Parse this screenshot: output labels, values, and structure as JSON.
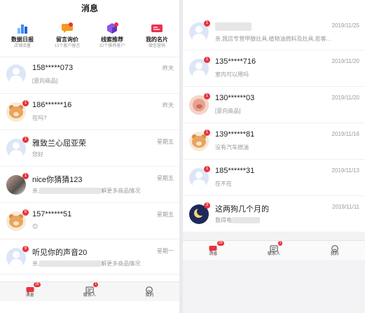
{
  "left": {
    "title": "消息",
    "tools": [
      {
        "title": "数据日报",
        "sub": "店铺流量",
        "icon": "bar-chart-icon",
        "color": "#3b8cf5"
      },
      {
        "title": "留言询价",
        "sub": "13个客户留言",
        "icon": "message-icon",
        "color": "#f29a1f"
      },
      {
        "title": "线索推荐",
        "sub": "32个推荐客户",
        "icon": "cube-icon",
        "color": "#8b57e8"
      },
      {
        "title": "我的名片",
        "sub": "微信营销",
        "icon": "card-icon",
        "color": "#e8334f"
      }
    ],
    "rows": [
      {
        "name": "158*****073",
        "time": "昨天",
        "preview": "[意向商品]",
        "avatar": "default",
        "badge": ""
      },
      {
        "name": "186******16",
        "time": "昨天",
        "preview": "在吗?",
        "avatar": "bear",
        "badge": "1"
      },
      {
        "name": "雅致兰心屈亚荣",
        "time": "星期五",
        "preview": "您好",
        "avatar": "default",
        "badge": "1"
      },
      {
        "name": "nice你猜猜123",
        "time": "星期五",
        "preview": "亲,",
        "preview_tail": "解更多商品情况",
        "avatar": "photo",
        "badge": "1"
      },
      {
        "name": "157******51",
        "time": "星期五",
        "preview": "😊",
        "avatar": "bear",
        "badge": "6"
      },
      {
        "name": "听见你的声音20",
        "time": "星期一",
        "preview": "亲,",
        "preview_tail": "解更多商品情况",
        "avatar": "default",
        "badge": "9"
      }
    ],
    "tabs": [
      {
        "label": "消息",
        "badge": "39",
        "icon": "chat-icon"
      },
      {
        "label": "联系人",
        "badge": "1",
        "icon": "contacts-icon"
      },
      {
        "label": "我的",
        "badge": "",
        "icon": "smile-icon"
      }
    ]
  },
  "right": {
    "rows": [
      {
        "name": "",
        "time": "2019/11/25",
        "preview": "亲,我店专营甲醇灶具,植物油燃料及灶具,若客...",
        "avatar": "default",
        "badge": "1"
      },
      {
        "name": "135*****716",
        "time": "2019/11/20",
        "preview": "室内可以用吗",
        "avatar": "default",
        "badge": "1"
      },
      {
        "name": "130******03",
        "time": "2019/11/20",
        "preview": "[意向商品]",
        "avatar": "pig",
        "badge": "1"
      },
      {
        "name": "139******81",
        "time": "2019/11/16",
        "preview": "没有汽车燃油",
        "avatar": "bear",
        "badge": "1"
      },
      {
        "name": "185******31",
        "time": "2019/11/13",
        "preview": "在不在",
        "avatar": "default",
        "badge": "1"
      },
      {
        "name": "这两狗几个月的",
        "time": "2019/11/11",
        "preview": "我得电",
        "avatar": "night",
        "badge": "3"
      }
    ],
    "tabs": [
      {
        "label": "消息",
        "badge": "39",
        "icon": "chat-icon"
      },
      {
        "label": "联系人",
        "badge": "1",
        "icon": "contacts-icon"
      },
      {
        "label": "我的",
        "badge": "",
        "icon": "smile-icon"
      }
    ]
  },
  "colors": {
    "accent": "#e8333c",
    "muted": "#999999"
  }
}
